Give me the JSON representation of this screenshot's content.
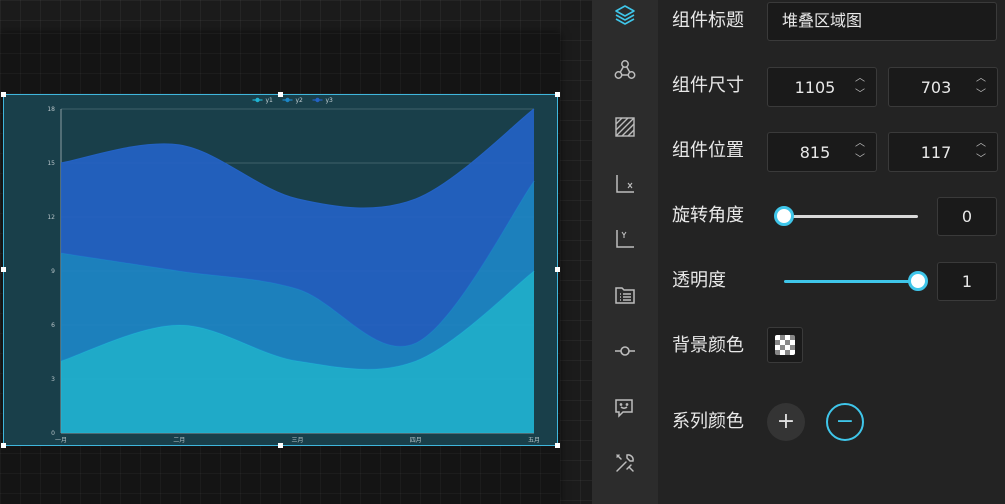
{
  "canvas": {
    "chart_data": {
      "type": "area",
      "stacked": true,
      "categories": [
        "一月",
        "二月",
        "三月",
        "四月",
        "五月"
      ],
      "series": [
        {
          "name": "y1",
          "values": [
            4,
            6,
            4,
            4,
            9
          ],
          "color": "#1fb3d2"
        },
        {
          "name": "y2",
          "values": [
            6,
            3,
            4,
            1,
            5
          ],
          "color": "#1c86c6"
        },
        {
          "name": "y3",
          "values": [
            5,
            7,
            5,
            8,
            4
          ],
          "color": "#2362c4"
        }
      ],
      "ylim": [
        0,
        18
      ],
      "yticks": [
        0,
        3,
        6,
        9,
        12,
        15,
        18
      ],
      "legend_position": "top-center",
      "grid": "horizontal"
    }
  },
  "iconbar": {
    "items": [
      {
        "icon": "layers-icon",
        "active": true
      },
      {
        "icon": "nodes-icon"
      },
      {
        "icon": "hatch-area-icon"
      },
      {
        "icon": "x-axis-icon"
      },
      {
        "icon": "y-axis-icon"
      },
      {
        "icon": "legend-list-icon"
      },
      {
        "icon": "marker-icon"
      },
      {
        "icon": "tooltip-icon"
      },
      {
        "icon": "tools-icon"
      }
    ],
    "active_color": "#3fc6ea"
  },
  "panel": {
    "title_label": "组件标题",
    "title_value": "堆叠区域图",
    "size_label": "组件尺寸",
    "width": "1105",
    "height": "703",
    "position_label": "组件位置",
    "pos_x": "815",
    "pos_y": "117",
    "rotation_label": "旋转角度",
    "rotation_value": "0",
    "rotation_level": 0,
    "opacity_label": "透明度",
    "opacity_value": "1",
    "opacity_level": 1,
    "background_label": "背景颜色",
    "series_color_label": "系列颜色",
    "add_symbol": "+",
    "remove_symbol": "−",
    "accent": "#3fc6ea"
  }
}
